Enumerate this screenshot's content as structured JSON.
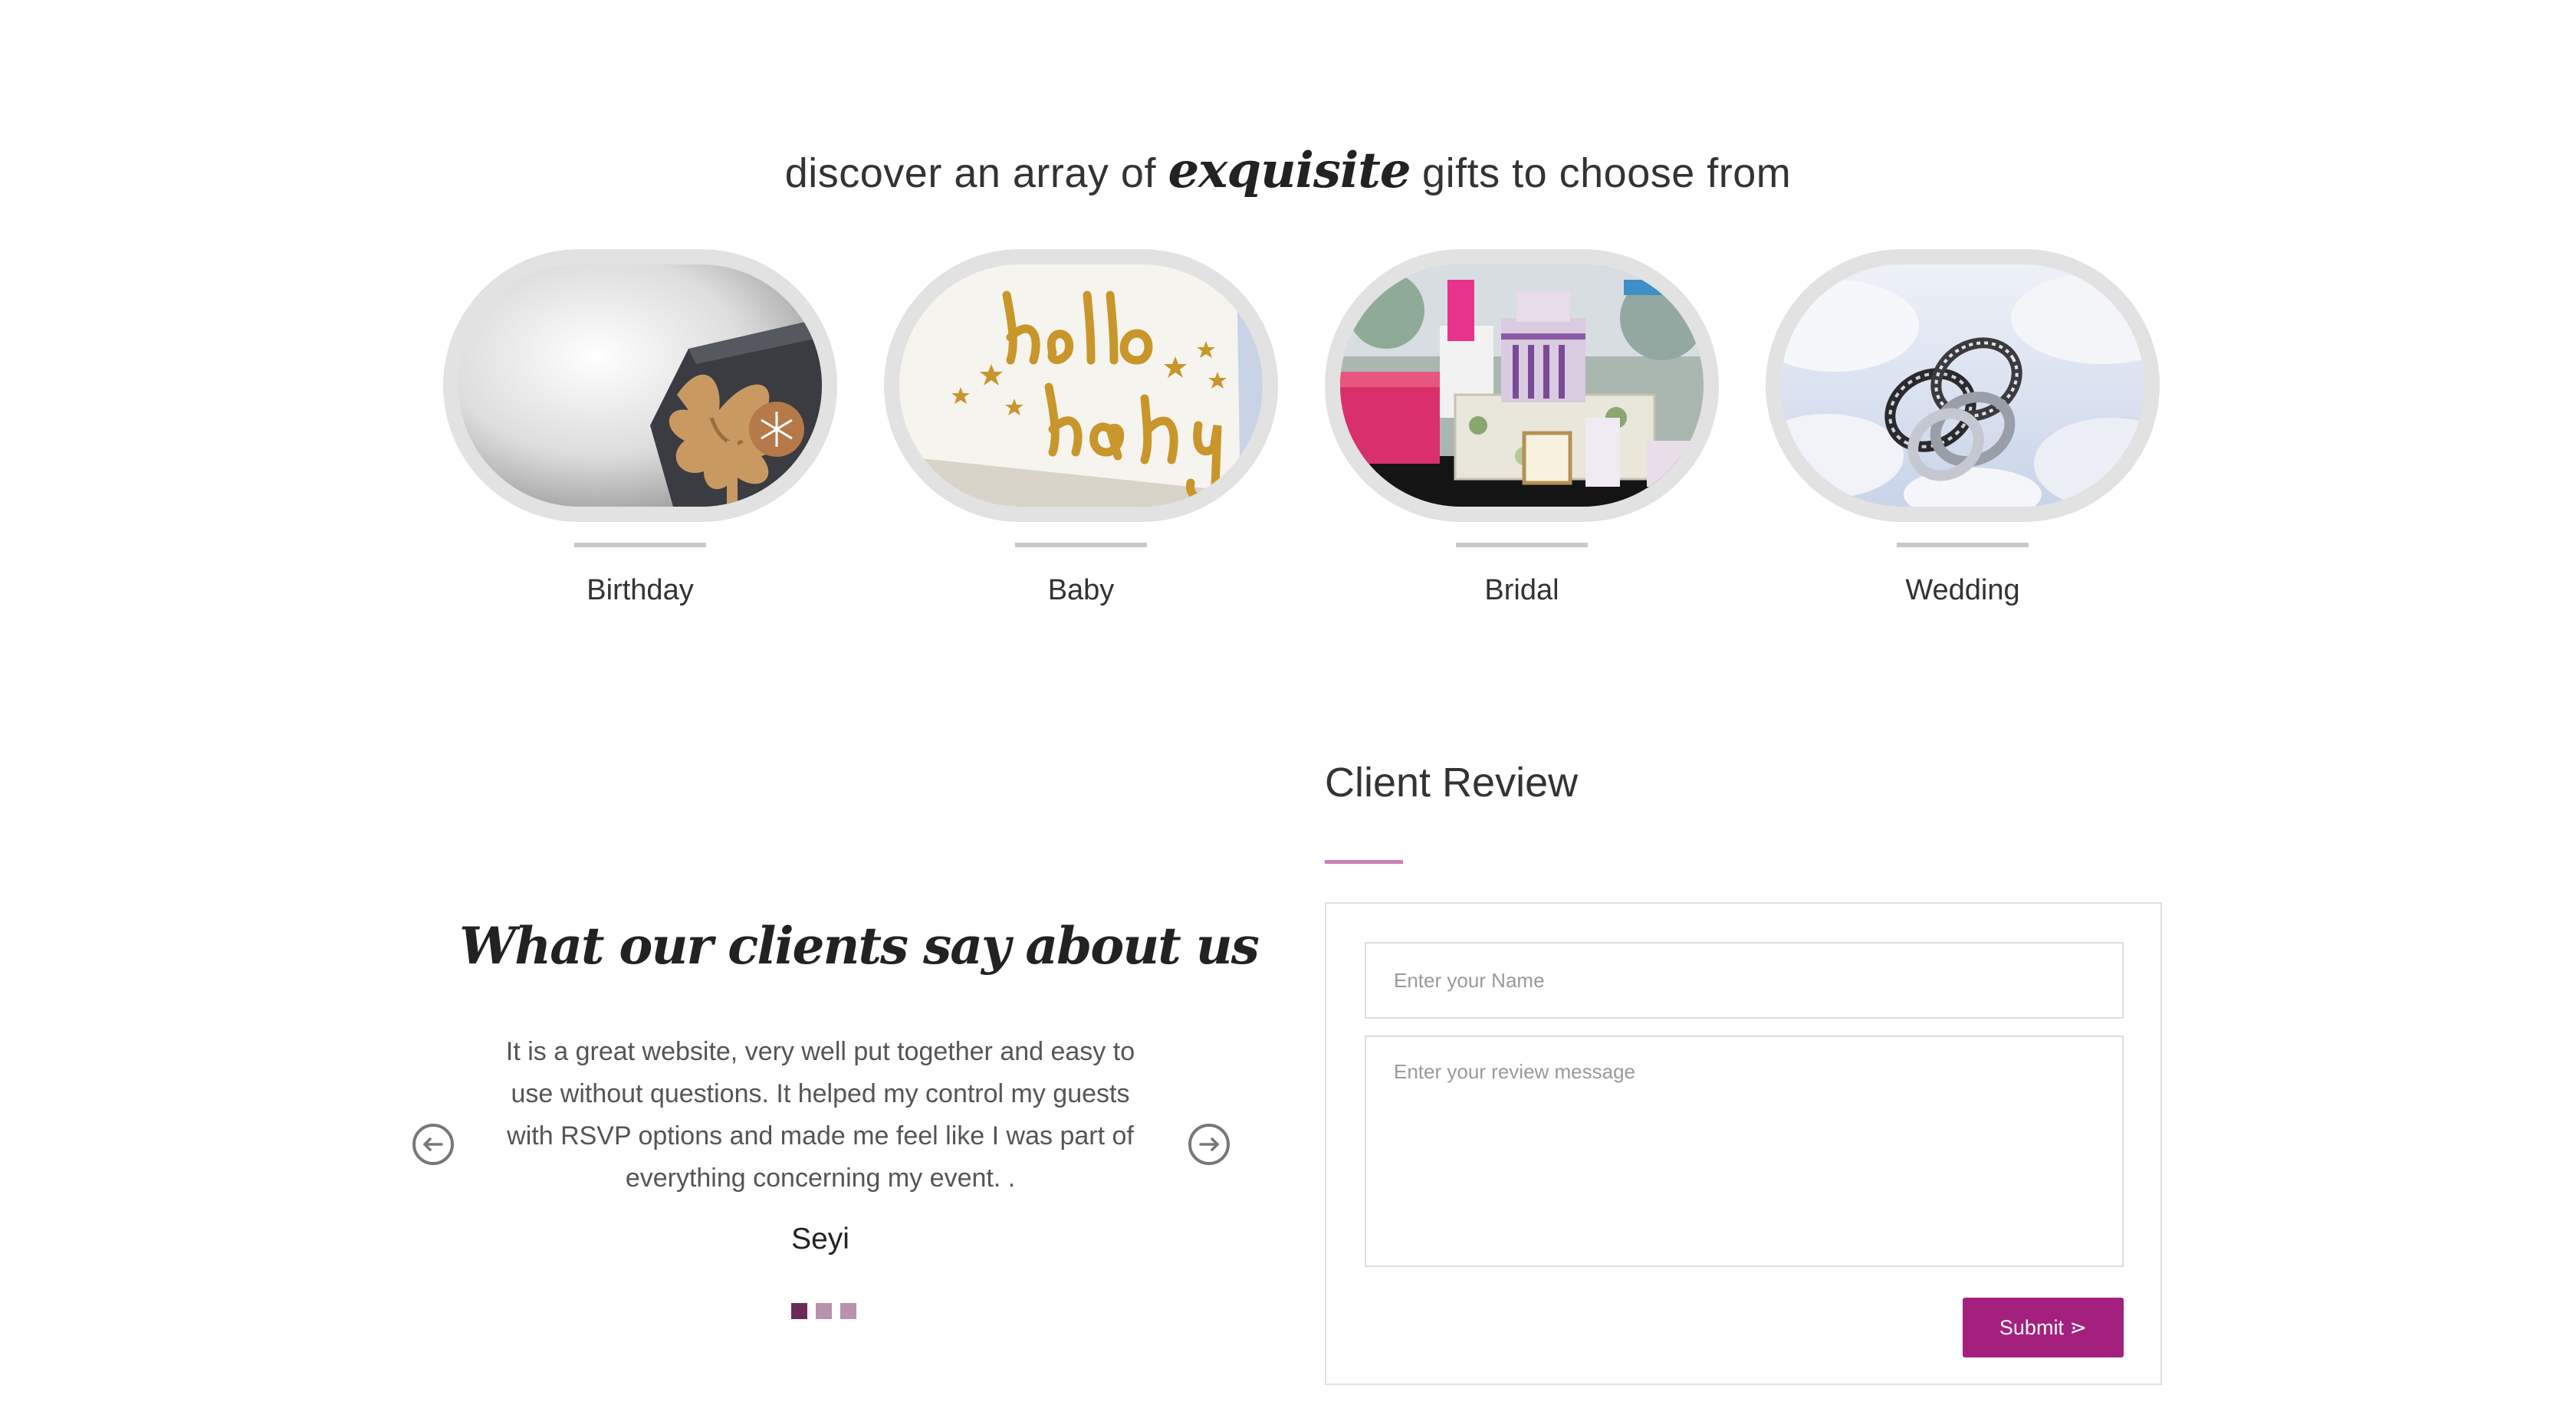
{
  "gifts": {
    "heading_before": "discover an array of ",
    "heading_accent": "exquisite",
    "heading_after": " gifts to choose from",
    "categories": [
      {
        "label": "Birthday"
      },
      {
        "label": "Baby"
      },
      {
        "label": "Bridal"
      },
      {
        "label": "Wedding"
      }
    ]
  },
  "testimonials": {
    "heading": "What our clients say about us",
    "text": "It is a great website, very well put together and easy to use without questions. It helped my control my guests with RSVP options and made me feel like I was part of everything concerning my event. .",
    "author": "Seyi",
    "pages": 3,
    "active_page": 1
  },
  "review": {
    "title": "Client Review",
    "name_placeholder": "Enter your Name",
    "message_placeholder": "Enter your review message",
    "submit_label": "Submit ⋗"
  },
  "colors": {
    "accent": "#a4207f",
    "accent_light": "#c880b4",
    "dot_active": "#6b2b58",
    "dot_inactive": "#b792ab"
  }
}
